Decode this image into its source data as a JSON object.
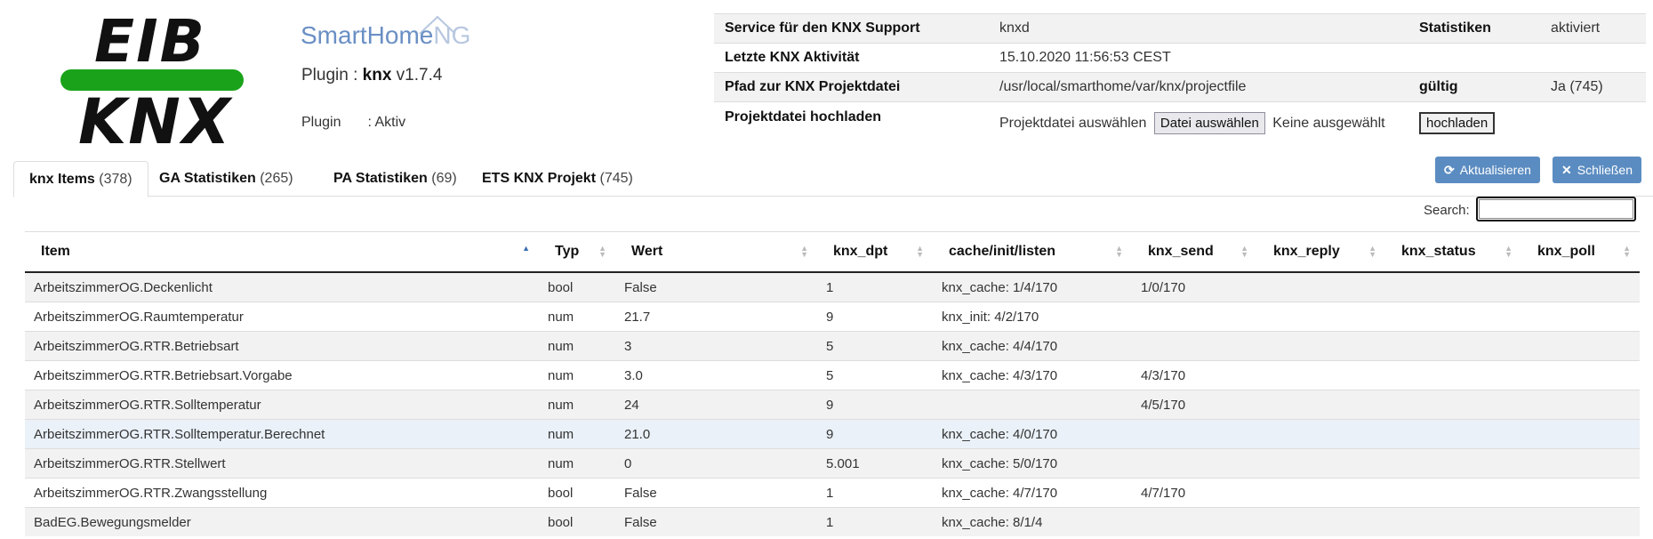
{
  "logo": {
    "top": "EIB",
    "bottom": "KNX"
  },
  "brand": {
    "main": "SmartHome",
    "suffix": "NG"
  },
  "plugin": {
    "prefix": "Plugin : ",
    "name": "knx",
    "version": " v1.7.4",
    "state_label": "Plugin",
    "state_value": ": Aktiv"
  },
  "info": {
    "service_label": "Service für den KNX Support",
    "service_value": "knxd",
    "stats_label": "Statistiken",
    "stats_value": "aktiviert",
    "activity_label": "Letzte KNX Aktivität",
    "activity_value": "15.10.2020 11:56:53 CEST",
    "path_label": "Pfad zur KNX Projektdatei",
    "path_value": "/usr/local/smarthome/var/knx/projectfile",
    "valid_label": "gültig",
    "valid_value": "Ja (745)",
    "upload_label": "Projektdatei hochladen",
    "upload_prompt": "Projektdatei auswählen",
    "file_button": "Datei auswählen",
    "file_none": "Keine ausgewählt",
    "upload_button": "hochladen"
  },
  "tabs": [
    {
      "label": "knx Items",
      "count": "(378)"
    },
    {
      "label": "GA Statistiken",
      "count": "(265)"
    },
    {
      "label": "PA Statistiken",
      "count": "(69)"
    },
    {
      "label": "ETS KNX Projekt",
      "count": "(745)"
    }
  ],
  "buttons": {
    "refresh": "Aktualisieren",
    "close": "Schließen"
  },
  "search": {
    "label": "Search:"
  },
  "table": {
    "columns": [
      "Item",
      "Typ",
      "Wert",
      "knx_dpt",
      "cache/init/listen",
      "knx_send",
      "knx_reply",
      "knx_status",
      "knx_poll"
    ],
    "rows": [
      [
        "ArbeitszimmerOG.Deckenlicht",
        "bool",
        "False",
        "1",
        "knx_cache: 1/4/170",
        "1/0/170",
        "",
        "",
        ""
      ],
      [
        "ArbeitszimmerOG.Raumtemperatur",
        "num",
        "21.7",
        "9",
        "knx_init: 4/2/170",
        "",
        "",
        "",
        ""
      ],
      [
        "ArbeitszimmerOG.RTR.Betriebsart",
        "num",
        "3",
        "5",
        "knx_cache: 4/4/170",
        "",
        "",
        "",
        ""
      ],
      [
        "ArbeitszimmerOG.RTR.Betriebsart.Vorgabe",
        "num",
        "3.0",
        "5",
        "knx_cache: 4/3/170",
        "4/3/170",
        "",
        "",
        ""
      ],
      [
        "ArbeitszimmerOG.RTR.Solltemperatur",
        "num",
        "24",
        "9",
        "",
        "4/5/170",
        "",
        "",
        ""
      ],
      [
        "ArbeitszimmerOG.RTR.Solltemperatur.Berechnet",
        "num",
        "21.0",
        "9",
        "knx_cache: 4/0/170",
        "",
        "",
        "",
        ""
      ],
      [
        "ArbeitszimmerOG.RTR.Stellwert",
        "num",
        "0",
        "5.001",
        "knx_cache: 5/0/170",
        "",
        "",
        "",
        ""
      ],
      [
        "ArbeitszimmerOG.RTR.Zwangsstellung",
        "bool",
        "False",
        "1",
        "knx_cache: 4/7/170",
        "4/7/170",
        "",
        "",
        ""
      ],
      [
        "BadEG.Bewegungsmelder",
        "bool",
        "False",
        "1",
        "knx_cache: 8/1/4",
        "",
        "",
        "",
        ""
      ]
    ]
  }
}
